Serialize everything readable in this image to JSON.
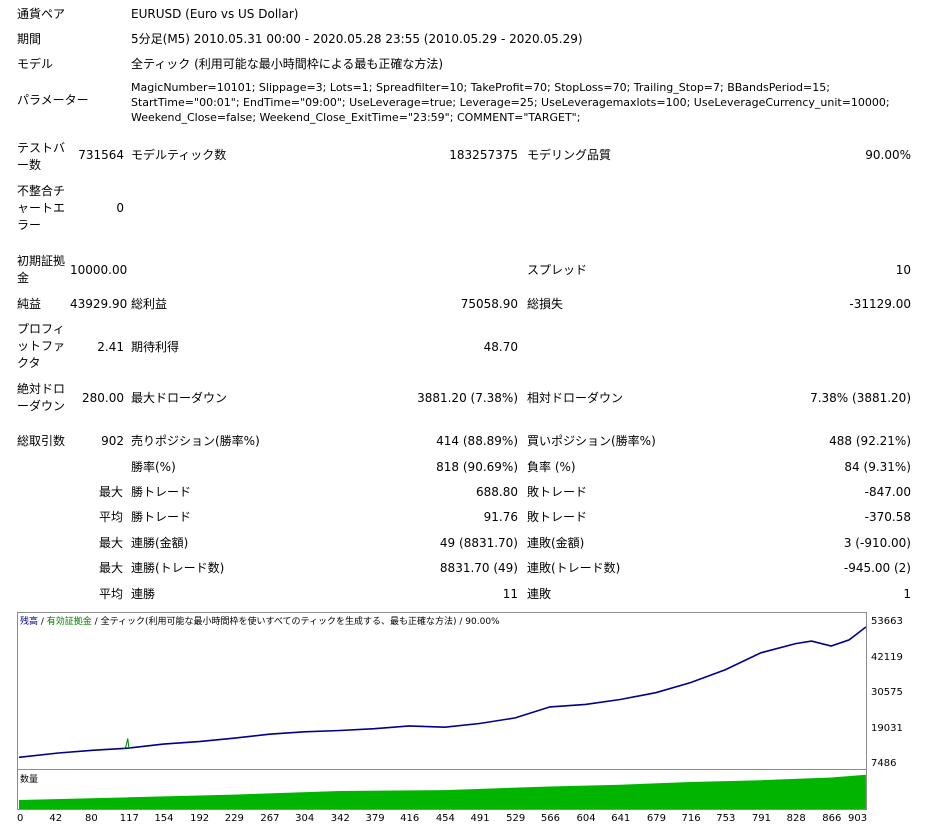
{
  "report": {
    "currency_pair": {
      "label": "通貨ペア",
      "value": "EURUSD (Euro vs US Dollar)"
    },
    "period": {
      "label": "期間",
      "value": "5分足(M5) 2010.05.31 00:00 - 2020.05.28 23:55 (2010.05.29 - 2020.05.29)"
    },
    "model": {
      "label": "モデル",
      "value": "全ティック (利用可能な最小時間枠による最も正確な方法)"
    },
    "parameters": {
      "label": "パラメーター",
      "value": "MagicNumber=10101; Slippage=3; Lots=1; Spreadfilter=10; TakeProfit=70; StopLoss=70; Trailing_Stop=7; BBandsPeriod=15; StartTime=\"00:01\"; EndTime=\"09:00\"; UseLeverage=true; Leverage=25; UseLeveragemaxlots=100; UseLeverageCurrency_unit=10000; Weekend_Close=false; Weekend_Close_ExitTime=\"23:59\"; COMMENT=\"TARGET\";"
    },
    "bars_tested": {
      "label": "テストバー数",
      "value": "731564"
    },
    "modeled_ticks": {
      "label": "モデルティック数",
      "value": "183257375"
    },
    "modeling_quality": {
      "label": "モデリング品質",
      "value": "90.00%"
    },
    "mismatched_chart_errors": {
      "label": "不整合チャートエラー",
      "value": "0"
    },
    "initial_deposit": {
      "label": "初期証拠金",
      "value": "10000.00"
    },
    "spread": {
      "label": "スプレッド",
      "value": "10"
    },
    "net_profit": {
      "label": "純益",
      "value": "43929.90"
    },
    "gross_profit": {
      "label": "総利益",
      "value": "75058.90"
    },
    "gross_loss": {
      "label": "総損失",
      "value": "-31129.00"
    },
    "profit_factor": {
      "label": "プロフィットファクタ",
      "value": "2.41"
    },
    "expected_payoff": {
      "label": "期待利得",
      "value": "48.70"
    },
    "absolute_drawdown": {
      "label": "絶対ドローダウン",
      "value": "280.00"
    },
    "maximal_drawdown": {
      "label": "最大ドローダウン",
      "value": "3881.20 (7.38%)"
    },
    "relative_drawdown": {
      "label": "相対ドローダウン",
      "value": "7.38% (3881.20)"
    },
    "total_trades": {
      "label": "総取引数",
      "value": "902"
    },
    "short_positions": {
      "label": "売りポジション(勝率%)",
      "value": "414 (88.89%)"
    },
    "long_positions": {
      "label": "買いポジション(勝率%)",
      "value": "488 (92.21%)"
    },
    "profit_trades": {
      "label": "勝率(%)",
      "value": "818 (90.69%)"
    },
    "loss_trades": {
      "label": "負率 (%)",
      "value": "84 (9.31%)"
    },
    "largest": {
      "prefix": "最大",
      "profit_label": "勝トレード",
      "profit_value": "688.80",
      "loss_label": "敗トレード",
      "loss_value": "-847.00"
    },
    "average": {
      "prefix": "平均",
      "profit_label": "勝トレード",
      "profit_value": "91.76",
      "loss_label": "敗トレード",
      "loss_value": "-370.58"
    },
    "max_consecutive_money": {
      "prefix": "最大",
      "win_label": "連勝(金額)",
      "win_value": "49 (8831.70)",
      "loss_label": "連敗(金額)",
      "loss_value": "3 (-910.00)"
    },
    "max_consecutive_count": {
      "prefix": "最大",
      "win_label": "連勝(トレード数)",
      "win_value": "8831.70 (49)",
      "loss_label": "連敗(トレード数)",
      "loss_value": "-945.00 (2)"
    },
    "average_consecutive": {
      "prefix": "平均",
      "win_label": "連勝",
      "win_value": "11",
      "loss_label": "連敗",
      "loss_value": "1"
    }
  },
  "chart_data": {
    "type": "line",
    "legend": {
      "balance": "残高",
      "sep1": " / ",
      "equity": "有効証拠金",
      "sep2": " / ",
      "model": "全ティック(利用可能な最小時間枠を使いすべてのティックを生成する、最も正確な方法)",
      "sep3": " / ",
      "quality": "90.00%"
    },
    "volume_label": "数量",
    "ylim": [
      7486,
      55000
    ],
    "xlim": [
      0,
      902
    ],
    "y_ticks": [
      53663,
      42119,
      30575,
      19031,
      7486
    ],
    "x_ticks": [
      0,
      42,
      80,
      117,
      154,
      192,
      229,
      267,
      304,
      342,
      379,
      416,
      454,
      491,
      529,
      566,
      604,
      641,
      679,
      716,
      753,
      791,
      828,
      866,
      903
    ],
    "series": [
      {
        "name": "残高",
        "color": "#00008b",
        "x": [
          0,
          42,
          80,
          117,
          154,
          192,
          229,
          267,
          304,
          342,
          379,
          416,
          454,
          491,
          529,
          566,
          604,
          641,
          679,
          716,
          753,
          791,
          828,
          845,
          866,
          885,
          903
        ],
        "y": [
          10000,
          11400,
          12300,
          13000,
          14300,
          15100,
          16200,
          17500,
          18300,
          18700,
          19300,
          20200,
          19800,
          21000,
          22800,
          26400,
          27200,
          28800,
          31000,
          34300,
          38500,
          44000,
          47000,
          47800,
          46200,
          48200,
          52400
        ]
      },
      {
        "name": "有効証拠金",
        "color": "#008000",
        "x": [
          112,
          114,
          116,
          117,
          119
        ],
        "y": [
          12700,
          13500,
          16100,
          13500,
          12800
        ]
      }
    ],
    "volume_color": "#00b400",
    "volume": {
      "x": [
        0,
        117,
        229,
        342,
        454,
        566,
        641,
        716,
        791,
        866,
        903
      ],
      "y": [
        1,
        1.3,
        1.6,
        2,
        2.1,
        2.5,
        2.7,
        3,
        3.2,
        3.5,
        3.8
      ]
    }
  }
}
